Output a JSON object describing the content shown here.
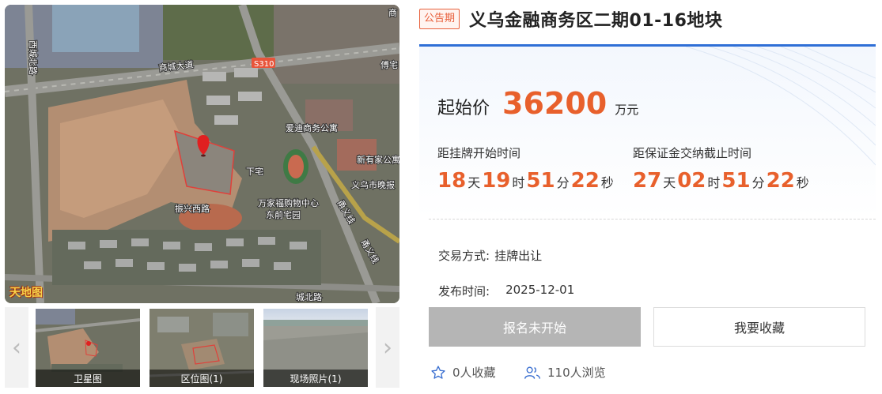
{
  "header": {
    "tag": "公告期",
    "title": "义乌金融商务区二期01-16地块"
  },
  "price": {
    "label": "起始价",
    "value": "36200",
    "unit": "万元"
  },
  "countdown_listing": {
    "label": "距挂牌开始时间",
    "days": "18",
    "days_unit": "天",
    "hours": "19",
    "hours_unit": "时",
    "minutes": "51",
    "minutes_unit": "分",
    "seconds": "22",
    "seconds_unit": "秒"
  },
  "countdown_deposit": {
    "label": "距保证金交纳截止时间",
    "days": "27",
    "days_unit": "天",
    "hours": "02",
    "hours_unit": "时",
    "minutes": "51",
    "minutes_unit": "分",
    "seconds": "22",
    "seconds_unit": "秒"
  },
  "details": {
    "trade_label": "交易方式:",
    "trade_value": "挂牌出让",
    "publish_label": "发布时间:",
    "publish_value": "2025-12-01"
  },
  "actions": {
    "signup_label": "报名未开始",
    "favorite_label": "我要收藏"
  },
  "stats": {
    "favorites": "0人收藏",
    "views": "110人浏览"
  },
  "map": {
    "logo": "天地图",
    "labels": {
      "shangcheng": "商城大道",
      "s310": "S310",
      "aidi": "爱迪商务公寓",
      "xinyoujia": "新有家公寓",
      "xiazhai": "下宅",
      "zhenxing": "振兴西路",
      "wanjia": "万家福购物中心",
      "dongqian": "东前宅园",
      "yiwu_hospital": "义乌市晚报",
      "yongyi1": "甬义线",
      "yongyi2": "甬义线",
      "chengbei": "城北路",
      "fuzhai": "傅宅",
      "top_right": "商",
      "left_road": "西城北路"
    }
  },
  "thumbnails": [
    {
      "caption": "卫星图"
    },
    {
      "caption": "区位图(1)"
    },
    {
      "caption": "现场照片(1)"
    }
  ],
  "colors": {
    "accent_orange": "#e8602c",
    "accent_blue": "#2f6fd6",
    "disabled_gray": "#b5b5b5"
  }
}
